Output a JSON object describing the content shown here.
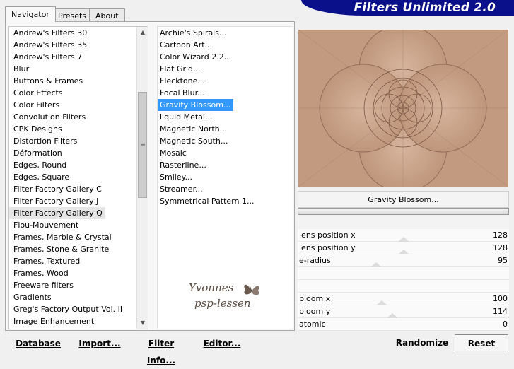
{
  "tabs": [
    "Navigator",
    "Presets",
    "About"
  ],
  "app_title": "Filters Unlimited 2.0",
  "categories": [
    "Andrew's Filters 30",
    "Andrew's Filters 35",
    "Andrew's Filters 7",
    "Blur",
    "Buttons & Frames",
    "Color Effects",
    "Color Filters",
    "Convolution Filters",
    "CPK Designs",
    "Distortion Filters",
    "Déformation",
    "Edges, Round",
    "Edges, Square",
    "Filter Factory Gallery C",
    "Filter Factory Gallery J",
    "Filter Factory Gallery Q",
    "Flou-Mouvement",
    "Frames, Marble & Crystal",
    "Frames, Stone & Granite",
    "Frames, Textured",
    "Frames, Wood",
    "Freeware filters",
    "Gradients",
    "Greg's Factory Output Vol. II",
    "Image Enhancement"
  ],
  "filters": [
    "Archie's Spirals...",
    "Cartoon Art...",
    "Color Wizard 2.2...",
    "Flat Grid...",
    "Flecktone...",
    "Focal Blur...",
    "Gravity Blossom...",
    "liquid Metal...",
    "Magnetic North...",
    "Magnetic South...",
    "Mosaic",
    "Rasterline...",
    "Smiley...",
    "Streamer...",
    "Symmetrical Pattern 1..."
  ],
  "watermark": {
    "line1": "Yvonnes",
    "line2": "psp-lessen"
  },
  "selected_filter": "Gravity Blossom...",
  "params": [
    {
      "label": "lens position x",
      "value": "128"
    },
    {
      "label": "lens position y",
      "value": "128"
    },
    {
      "label": "e-radius",
      "value": "95"
    },
    {
      "label": "bloom x",
      "value": "100"
    },
    {
      "label": "bloom y",
      "value": "114"
    },
    {
      "label": "atomic",
      "value": "0"
    }
  ],
  "buttons": {
    "database": "Database",
    "import": "Import...",
    "filter_info": "Filter Info...",
    "editor": "Editor...",
    "randomize": "Randomize",
    "reset": "Reset"
  },
  "colors": {
    "banner": "#0a0f8a",
    "selection": "#3399ff",
    "preview_bg": "#c29a80"
  }
}
